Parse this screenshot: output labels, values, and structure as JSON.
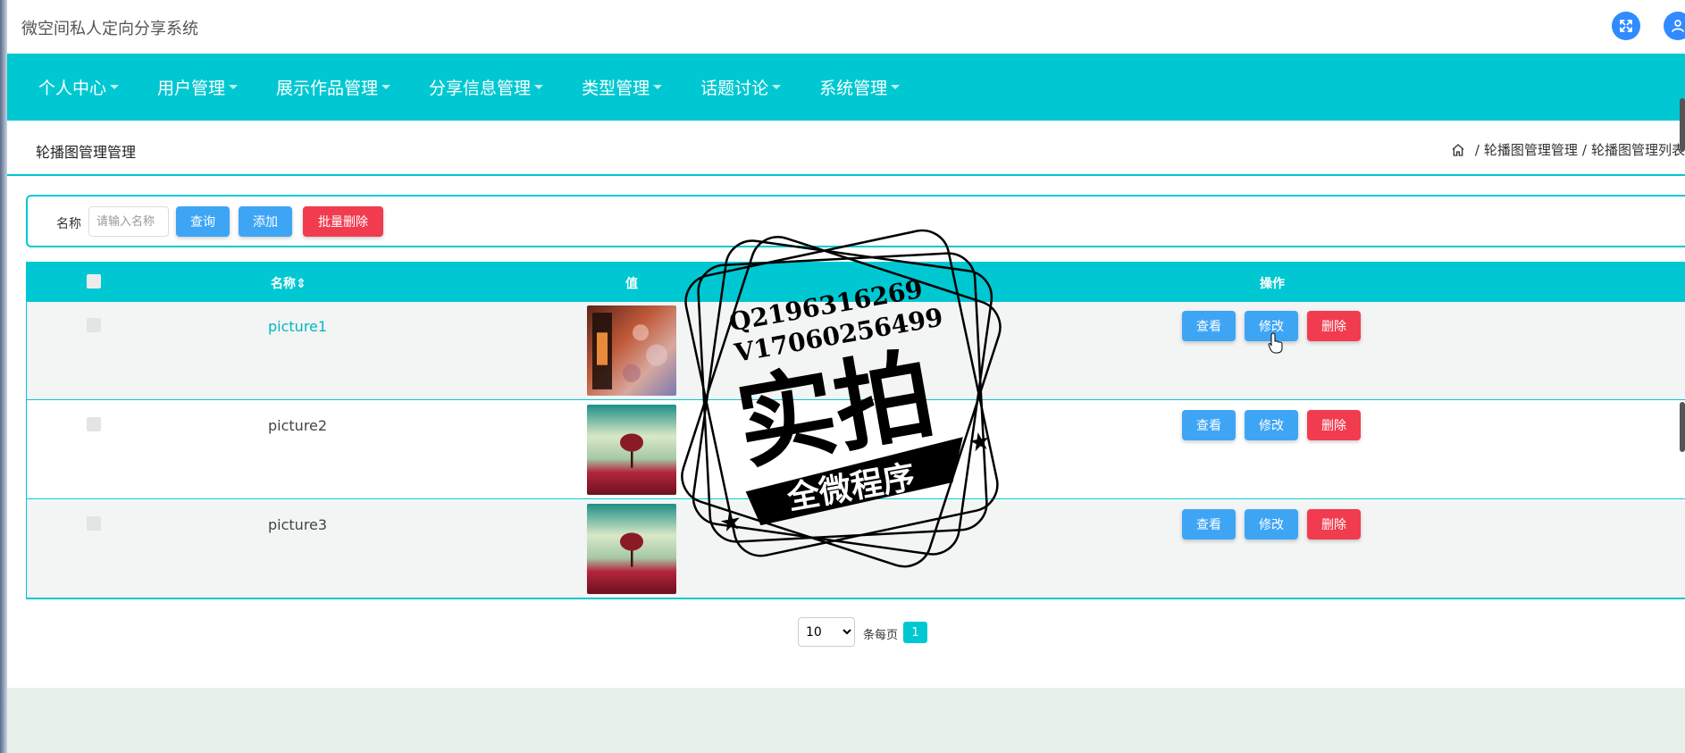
{
  "header": {
    "app_title": "微空间私人定向分享系统",
    "icons": [
      "fullscreen-icon",
      "user-icon"
    ],
    "accent_color": "#00c8d2",
    "icon_color": "#2f8bff"
  },
  "nav": {
    "items": [
      {
        "label": "个人中心"
      },
      {
        "label": "用户管理"
      },
      {
        "label": "展示作品管理"
      },
      {
        "label": "分享信息管理"
      },
      {
        "label": "类型管理"
      },
      {
        "label": "话题讨论"
      },
      {
        "label": "系统管理"
      }
    ]
  },
  "breadcrumb": {
    "page_title": "轮播图管理管理",
    "home_icon": "home-icon",
    "crumb1": "轮播图管理管理",
    "crumb2": "轮播图管理列表",
    "separator": "/"
  },
  "search": {
    "label": "名称",
    "placeholder": "请输入名称",
    "query_button": "查询",
    "add_button": "添加",
    "batch_delete_button": "批量删除"
  },
  "table": {
    "columns": {
      "name": "名称",
      "value": "值",
      "actions": "操作"
    },
    "rows": [
      {
        "name": "picture1",
        "image": "lantern-bokeh-photo"
      },
      {
        "name": "picture2",
        "image": "red-tree-field-photo"
      },
      {
        "name": "picture3",
        "image": "red-tree-field-photo"
      }
    ],
    "view_label": "查看",
    "edit_label": "修改",
    "delete_label": "删除"
  },
  "pagination": {
    "page_size": "10",
    "page_size_options": [
      "10"
    ],
    "per_page_label": "条每页",
    "current_page": "1"
  },
  "watermark": {
    "line1": "Q2196316269",
    "line2": "V17060256499",
    "main": "实拍",
    "banner": "全微程序"
  }
}
